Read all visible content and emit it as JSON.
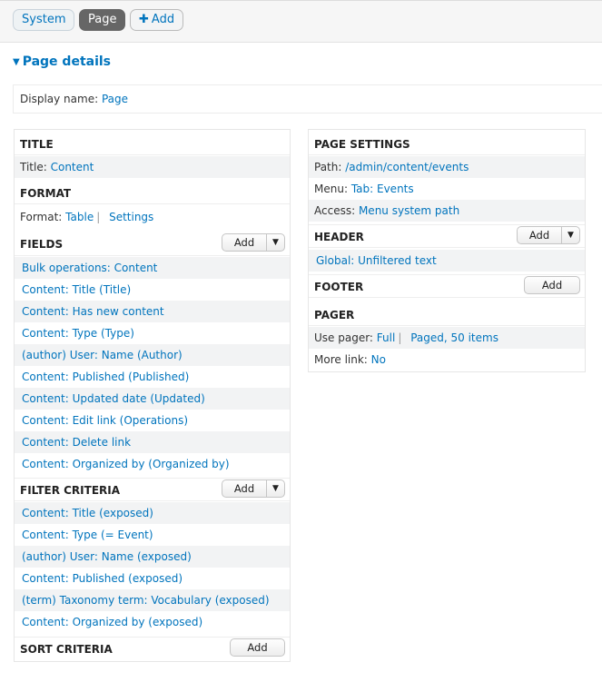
{
  "tabs": {
    "system": "System",
    "page": "Page",
    "add": "Add"
  },
  "details": {
    "heading": "Page details",
    "display_name_label": "Display name:",
    "display_name_value": "Page"
  },
  "left": {
    "title_section": {
      "heading": "TITLE",
      "label": "Title:",
      "value": "Content"
    },
    "format_section": {
      "heading": "FORMAT",
      "label": "Format:",
      "value": "Table",
      "settings": "Settings"
    },
    "fields_section": {
      "heading": "FIELDS",
      "add": "Add",
      "items": [
        "Bulk operations: Content",
        "Content: Title (Title)",
        "Content: Has new content",
        "Content: Type (Type)",
        "(author) User: Name (Author)",
        "Content: Published (Published)",
        "Content: Updated date (Updated)",
        "Content: Edit link (Operations)",
        "Content: Delete link",
        "Content: Organized by (Organized by)"
      ]
    },
    "filter_section": {
      "heading": "FILTER CRITERIA",
      "add": "Add",
      "items": [
        "Content: Title (exposed)",
        "Content: Type (= Event)",
        "(author) User: Name (exposed)",
        "Content: Published (exposed)",
        "(term) Taxonomy term: Vocabulary (exposed)",
        "Content: Organized by (exposed)"
      ]
    },
    "sort_section": {
      "heading": "SORT CRITERIA",
      "add": "Add"
    }
  },
  "right": {
    "page_settings": {
      "heading": "PAGE SETTINGS",
      "path_label": "Path:",
      "path_value": "/admin/content/events",
      "menu_label": "Menu:",
      "menu_value": "Tab: Events",
      "access_label": "Access:",
      "access_value": "Menu system path"
    },
    "header_section": {
      "heading": "HEADER",
      "add": "Add",
      "item": "Global: Unfiltered text"
    },
    "footer_section": {
      "heading": "FOOTER",
      "add": "Add"
    },
    "pager_section": {
      "heading": "PAGER",
      "use_pager_label": "Use pager:",
      "use_pager_value": "Full",
      "use_pager_detail": "Paged, 50 items",
      "more_link_label": "More link:",
      "more_link_value": "No"
    }
  }
}
